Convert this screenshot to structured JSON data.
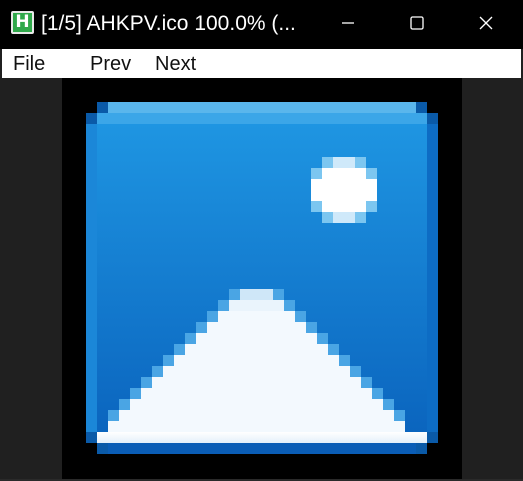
{
  "window": {
    "title": "[1/5] AHKPV.ico 100.0% (...",
    "app_icon_letter": "H"
  },
  "menu": {
    "file": "File",
    "prev": "Prev",
    "next": "Next"
  },
  "colors": {
    "titlebar": "#000000",
    "menubar": "#ffffff",
    "side_panel": "#202020",
    "icon_blue": "#1a82d6",
    "icon_light_blue": "#4fb0ec",
    "icon_white": "#f3f8fd"
  },
  "icons": {
    "minimize": "minimize-icon",
    "maximize": "maximize-icon",
    "close": "close-icon",
    "image_content": "picture-icon"
  }
}
